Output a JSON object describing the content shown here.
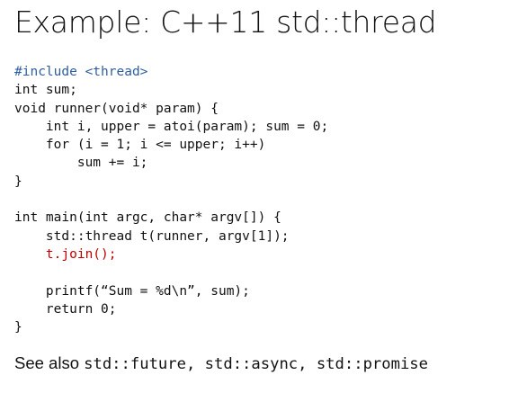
{
  "slide": {
    "title": "Example: C++11 std::thread"
  },
  "code": {
    "lines": [
      {
        "text": "#include <thread>",
        "color": "#2f5e9e"
      },
      {
        "text": "int sum;",
        "color": "#111111"
      },
      {
        "text": "void runner(void* param) {",
        "color": "#111111"
      },
      {
        "text": "    int i, upper = atoi(param); sum = 0;",
        "color": "#111111"
      },
      {
        "text": "    for (i = 1; i <= upper; i++)",
        "color": "#111111"
      },
      {
        "text": "        sum += i;",
        "color": "#111111"
      },
      {
        "text": "}",
        "color": "#111111"
      },
      {
        "text": "",
        "color": "#111111"
      },
      {
        "text": "int main(int argc, char* argv[]) {",
        "color": "#111111"
      },
      {
        "text": "    std::thread t(runner, argv[1]);",
        "color": "#111111"
      },
      {
        "text": "    t.join();",
        "color": "#c00000"
      },
      {
        "text": "",
        "color": "#111111"
      },
      {
        "text": "    printf(“Sum = %d\\n”, sum);",
        "color": "#111111"
      },
      {
        "text": "    return 0;",
        "color": "#111111"
      },
      {
        "text": "}",
        "color": "#111111"
      }
    ]
  },
  "see_also": {
    "prefix": "See also ",
    "apis": "std::future, std::async, std::promise"
  }
}
